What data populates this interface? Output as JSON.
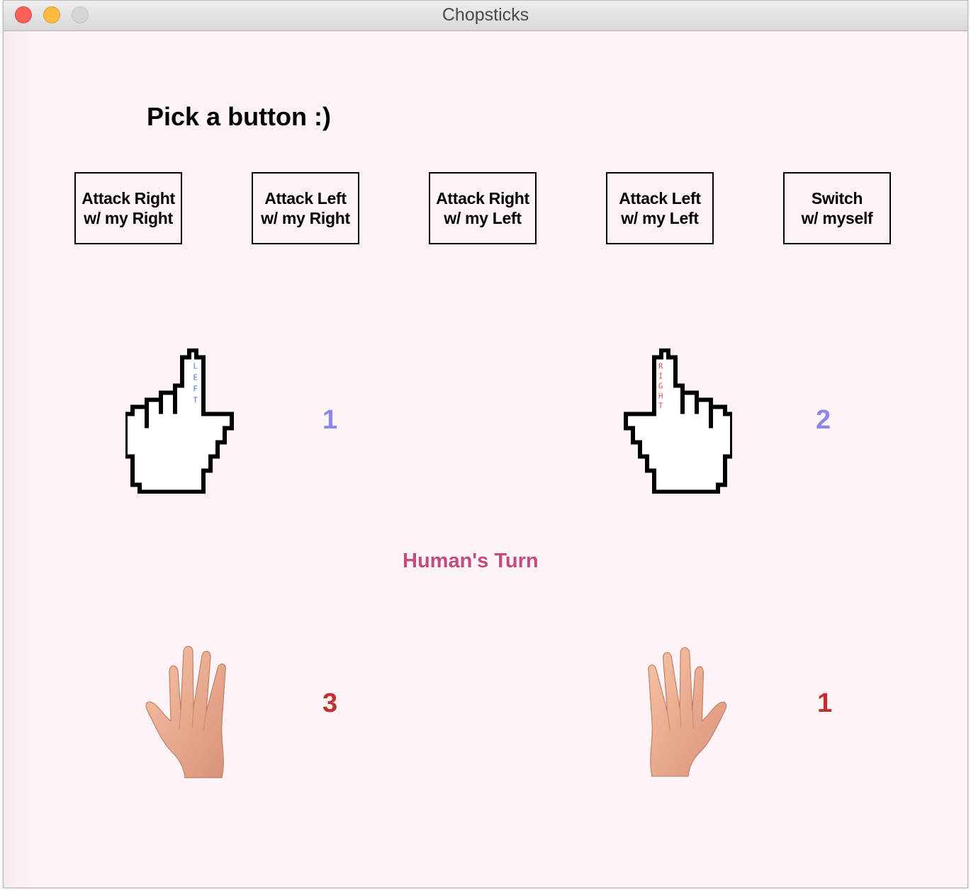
{
  "window": {
    "title": "Chopsticks"
  },
  "prompt": "Pick a button :)",
  "buttons": [
    {
      "line1": "Attack Right",
      "line2": "w/ my Right"
    },
    {
      "line1": "Attack Left",
      "line2": "w/ my Right"
    },
    {
      "line1": "Attack Right",
      "line2": "w/ my Left"
    },
    {
      "line1": "Attack Left",
      "line2": "w/ my Left"
    },
    {
      "line1": "Switch",
      "line2": "w/ myself"
    }
  ],
  "computer": {
    "left_hand": {
      "finger_label": "LEFT",
      "count": "1"
    },
    "right_hand": {
      "finger_label": "RIGHT",
      "count": "2"
    }
  },
  "turn_text": "Human's Turn",
  "human": {
    "left_hand": {
      "count": "3"
    },
    "right_hand": {
      "count": "1"
    }
  },
  "colors": {
    "background": "#fef4f8",
    "computer_count": "#8c87ea",
    "human_count": "#c0302f",
    "turn_text": "#c34c7b",
    "left_finger_label": "#4a6fd0",
    "right_finger_label": "#e84a4a"
  },
  "icons": {
    "computer_left": "pointing-hand-cursor-icon",
    "computer_right": "pointing-hand-cursor-icon",
    "human_left": "open-palm-hand-icon",
    "human_right": "open-palm-hand-icon"
  }
}
